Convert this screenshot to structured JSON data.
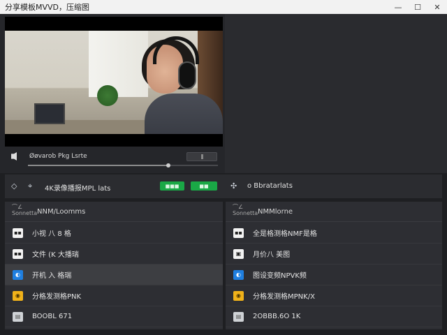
{
  "window": {
    "title": "分享模板MVVD，压缩图",
    "minimize_glyph": "—",
    "maximize_glyph": "☐",
    "close_glyph": "✕"
  },
  "player": {
    "label": "Øøvarob Pkg Lsrte",
    "progress_fraction": 0.74
  },
  "toolbar": {
    "left_label": "4K录像播报MPL lats",
    "btn1_label": "■■■",
    "btn2_label": "■■",
    "right_label": "o Bbratarlats"
  },
  "left_panel": {
    "header_icon": "Sonnetta",
    "title": "NNM/Loomms",
    "items": [
      {
        "icon": "video-icon",
        "glyph": "▪▪",
        "label": "小视 八 8 格",
        "selected": false
      },
      {
        "icon": "video-icon",
        "glyph": "▪▪",
        "label": "文件 (K 大播瑞",
        "selected": false
      },
      {
        "icon": "blue-file-icon",
        "glyph": "◐",
        "label": "开机 入 格瑞",
        "selected": true
      },
      {
        "icon": "yellow-file-icon",
        "glyph": "◉",
        "label": "分格发测格PNK",
        "selected": false
      },
      {
        "icon": "doc-icon",
        "glyph": "▤",
        "label": "BOOBL 671",
        "selected": false
      }
    ]
  },
  "right_panel": {
    "header_icon": "Sonnetta",
    "title": "NMMlorne",
    "items": [
      {
        "icon": "video-icon",
        "glyph": "▪▪",
        "label": "全是格测格NMF是格",
        "selected": false
      },
      {
        "icon": "image-icon",
        "glyph": "▣",
        "label": "月价八 美图",
        "selected": false
      },
      {
        "icon": "blue-file-icon",
        "glyph": "◐",
        "label": "图设变频NPVK频",
        "selected": false
      },
      {
        "icon": "yellow-file-icon",
        "glyph": "◉",
        "label": "分格发测格MPNK/X",
        "selected": false
      },
      {
        "icon": "doc-icon",
        "glyph": "▤",
        "label": "2OBBB.6O 1K",
        "selected": false
      }
    ]
  }
}
